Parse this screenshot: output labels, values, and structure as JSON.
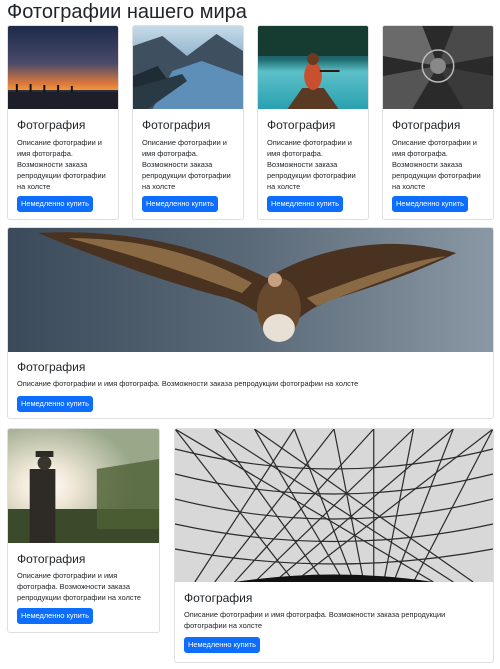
{
  "page": {
    "title": "Фотографии нашего мира"
  },
  "cards": [
    {
      "title": "Фотография",
      "text": "Описание фотографии и имя фотографа. Возможности заказа репродукции фотографии на холсте",
      "button": "Немедленно купить",
      "image": "sunset-pier-photo"
    },
    {
      "title": "Фотография",
      "text": "Описание фотографии и имя фотографа. Возможности заказа репродукции фотографии на холсте",
      "button": "Немедленно купить",
      "image": "mountain-lake-photo"
    },
    {
      "title": "Фотография",
      "text": "Описание фотографии и имя фотографа. Возможности заказа репродукции фотографии на холсте",
      "button": "Немедленно купить",
      "image": "canoe-woman-photo"
    },
    {
      "title": "Фотография",
      "text": "Описание фотографии и имя фотографа. Возможности заказа репродукции фотографии на холсте",
      "button": "Немедленно купить",
      "image": "architecture-photo"
    },
    {
      "title": "Фотография",
      "text": "Описание фотографии и имя фотографа. Возможности заказа репродукции фотографии на холсте",
      "button": "Немедленно купить",
      "image": "vulture-photo"
    },
    {
      "title": "Фотография",
      "text": "Описание фотографии и имя фотографа. Возможности заказа репродукции фотографии на холсте",
      "button": "Немедленно купить",
      "image": "man-sunlight-photo"
    },
    {
      "title": "Фотография",
      "text": "Описание фотографии и имя фотографа. Возможности заказа репродукции фотографии на холсте",
      "button": "Немедленно купить",
      "image": "glass-dome-photo"
    }
  ],
  "colors": {
    "button": "#0d6efd",
    "text": "#212529",
    "border": "#dfdfdf"
  }
}
